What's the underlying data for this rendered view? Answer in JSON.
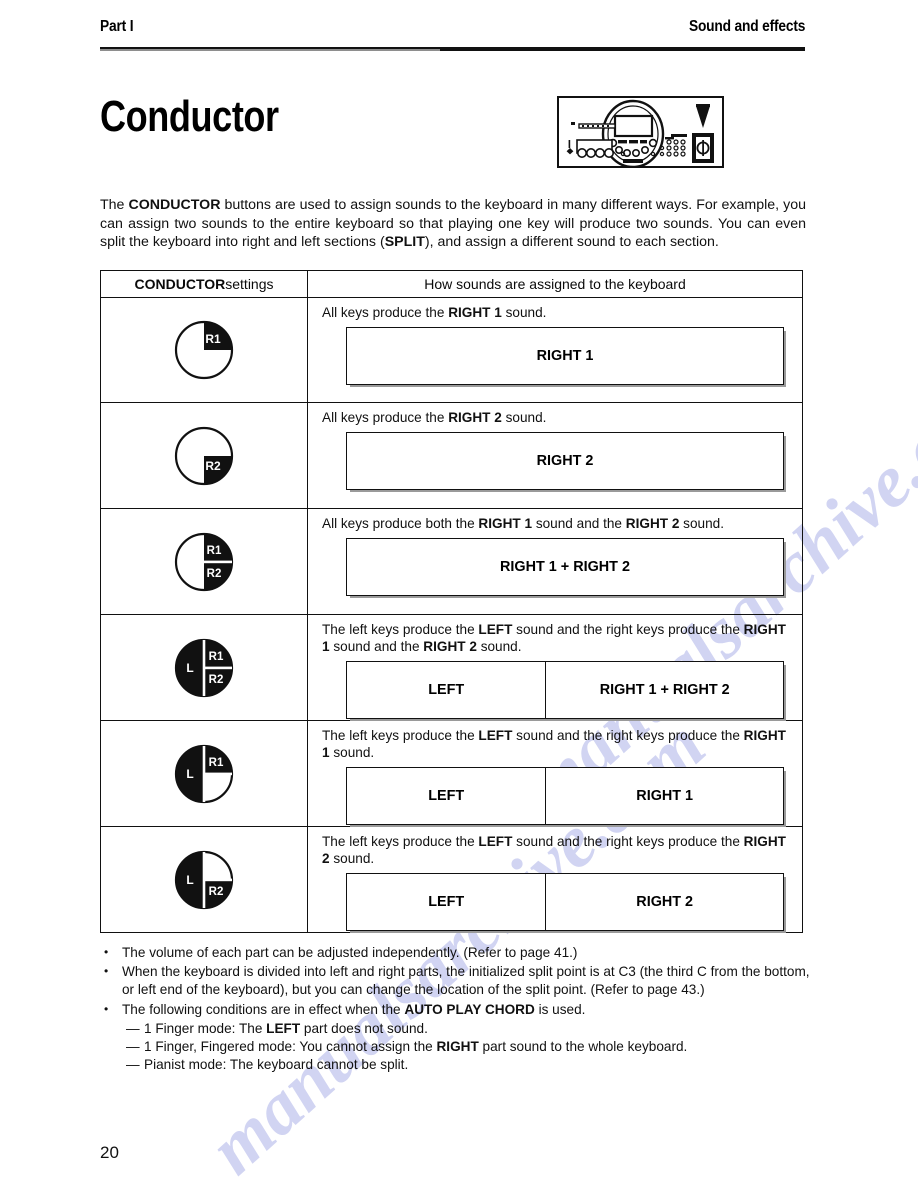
{
  "runhead": {
    "left": "Part I",
    "right": "Sound and effects"
  },
  "title": "Conductor",
  "watermark": {
    "line1": "manualsarchive.com",
    "line2": "manualsarchive.com"
  },
  "intro": {
    "p1_a": "The ",
    "p1_b1": "CONDUCTOR",
    "p1_c": " buttons are used to assign sounds to the keyboard in many different ways. For example, you can assign two sounds to the entire keyboard so that playing one key will produce two sounds. You can even split the keyboard into right and left sections (",
    "p1_b2": "SPLIT",
    "p1_d": "), and assign a different sound to each section."
  },
  "table": {
    "header": {
      "col1_bold": "CONDUCTOR",
      "col1_rest": " settings",
      "col2": "How sounds are assigned to the keyboard"
    },
    "rows": [
      {
        "icon": "conductor-dial-right1",
        "icon_labels": [
          "R1"
        ],
        "desc_a": "All keys produce the ",
        "desc_b": "RIGHT 1",
        "desc_c": " sound.",
        "segments": [
          {
            "label": "RIGHT 1",
            "width": "full"
          }
        ]
      },
      {
        "icon": "conductor-dial-right2",
        "icon_labels": [
          "R2"
        ],
        "desc_a": "All keys produce the ",
        "desc_b": "RIGHT 2",
        "desc_c": " sound.",
        "segments": [
          {
            "label": "RIGHT 2",
            "width": "full"
          }
        ]
      },
      {
        "icon": "conductor-dial-right1-right2",
        "icon_labels": [
          "R1",
          "R2"
        ],
        "desc_a": "All keys produce both the ",
        "desc_b": "RIGHT 1",
        "desc_c": " sound and the ",
        "desc_d": "RIGHT 2",
        "desc_e": " sound.",
        "segments": [
          {
            "label": "RIGHT 1 + RIGHT 2",
            "width": "full"
          }
        ]
      },
      {
        "icon": "conductor-dial-left-right1-right2",
        "icon_labels": [
          "L",
          "R1",
          "R2"
        ],
        "desc_a": "The left keys produce the ",
        "desc_b": "LEFT",
        "desc_c": " sound and the right keys produce the ",
        "desc_d": "RIGHT 1",
        "desc_e": " sound and the ",
        "desc_f": "RIGHT 2",
        "desc_g": " sound.",
        "segments": [
          {
            "label": "LEFT",
            "width": "left"
          },
          {
            "label": "RIGHT 1 + RIGHT 2",
            "width": "right"
          }
        ]
      },
      {
        "icon": "conductor-dial-left-right1",
        "icon_labels": [
          "L",
          "R1"
        ],
        "desc_a": "The left keys produce the ",
        "desc_b": "LEFT",
        "desc_c": " sound and the right keys produce the ",
        "desc_d": "RIGHT 1",
        "desc_e": " sound.",
        "segments": [
          {
            "label": "LEFT",
            "width": "left"
          },
          {
            "label": "RIGHT 1",
            "width": "right"
          }
        ]
      },
      {
        "icon": "conductor-dial-left-right2",
        "icon_labels": [
          "L",
          "R2"
        ],
        "desc_a": "The left keys produce the ",
        "desc_b": "LEFT",
        "desc_c": " sound and the right keys produce the ",
        "desc_d": "RIGHT 2",
        "desc_e": " sound.",
        "segments": [
          {
            "label": "LEFT",
            "width": "left"
          },
          {
            "label": "RIGHT 2",
            "width": "right"
          }
        ]
      }
    ]
  },
  "notes": {
    "n1": "The volume of each part can be adjusted independently. (Refer to page 41.)",
    "n2": "When the keyboard is divided into left and right parts, the initialized split point is at C3 (the third C from the bottom, or left end of the keyboard), but you can change the location of the split point. (Refer to page 43.)",
    "n3_a": "The following conditions are in effect when the ",
    "n3_b": "AUTO PLAY CHORD",
    "n3_c": " is used.",
    "s1_a": "1 Finger mode: The ",
    "s1_b": "LEFT",
    "s1_c": " part does not sound.",
    "s2_a": "1 Finger, Fingered mode: You cannot assign the ",
    "s2_b": "RIGHT",
    "s2_c": " part sound to the whole keyboard.",
    "s3": "Pianist mode: The keyboard cannot be split.",
    "dash": "—",
    "bullet": "•"
  },
  "folio": "20",
  "device": {
    "name": "keyboard-control-panel-illustration",
    "highlight_label": "conductor-section-highlight",
    "arrow_label": "down-arrow-pointer"
  },
  "colors": {
    "ink": "#111111",
    "watermark": "#c9cdf0",
    "shadow": "#9a9a9a"
  }
}
